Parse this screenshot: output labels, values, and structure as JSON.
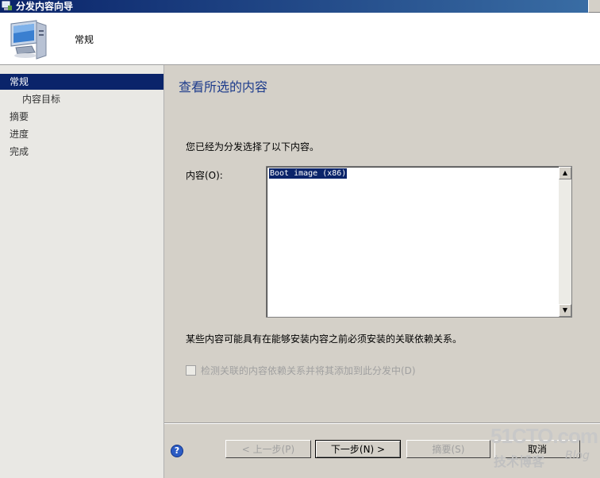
{
  "window": {
    "title": "分发内容向导"
  },
  "header": {
    "title": "常规",
    "icon": "computer-icon"
  },
  "sidebar": {
    "items": [
      {
        "label": "常规",
        "active": true
      },
      {
        "label": "内容目标",
        "active": false
      },
      {
        "label": "摘要",
        "active": false
      },
      {
        "label": "进度",
        "active": false
      },
      {
        "label": "完成",
        "active": false
      }
    ]
  },
  "main": {
    "title": "查看所选的内容",
    "intro": "您已经为分发选择了以下内容。",
    "content_label": "内容(O):",
    "content_items": [
      "Boot image (x86)"
    ],
    "dependency_note": "某些内容可能具有在能够安装内容之前必须安装的关联依赖关系。",
    "checkbox_label": "检测关联的内容依赖关系并将其添加到此分发中(D)",
    "checkbox_checked": false
  },
  "buttons": {
    "prev": "< 上一步(P)",
    "next": "下一步(N) >",
    "summary": "摘要(S)",
    "cancel": "取消"
  },
  "watermark": {
    "main": "51CTO.com",
    "sub": "技术博客",
    "blog": "Blog"
  },
  "colors": {
    "selection": "#0a246a",
    "title_text": "#1e3c8c",
    "background": "#d4d0c8"
  }
}
